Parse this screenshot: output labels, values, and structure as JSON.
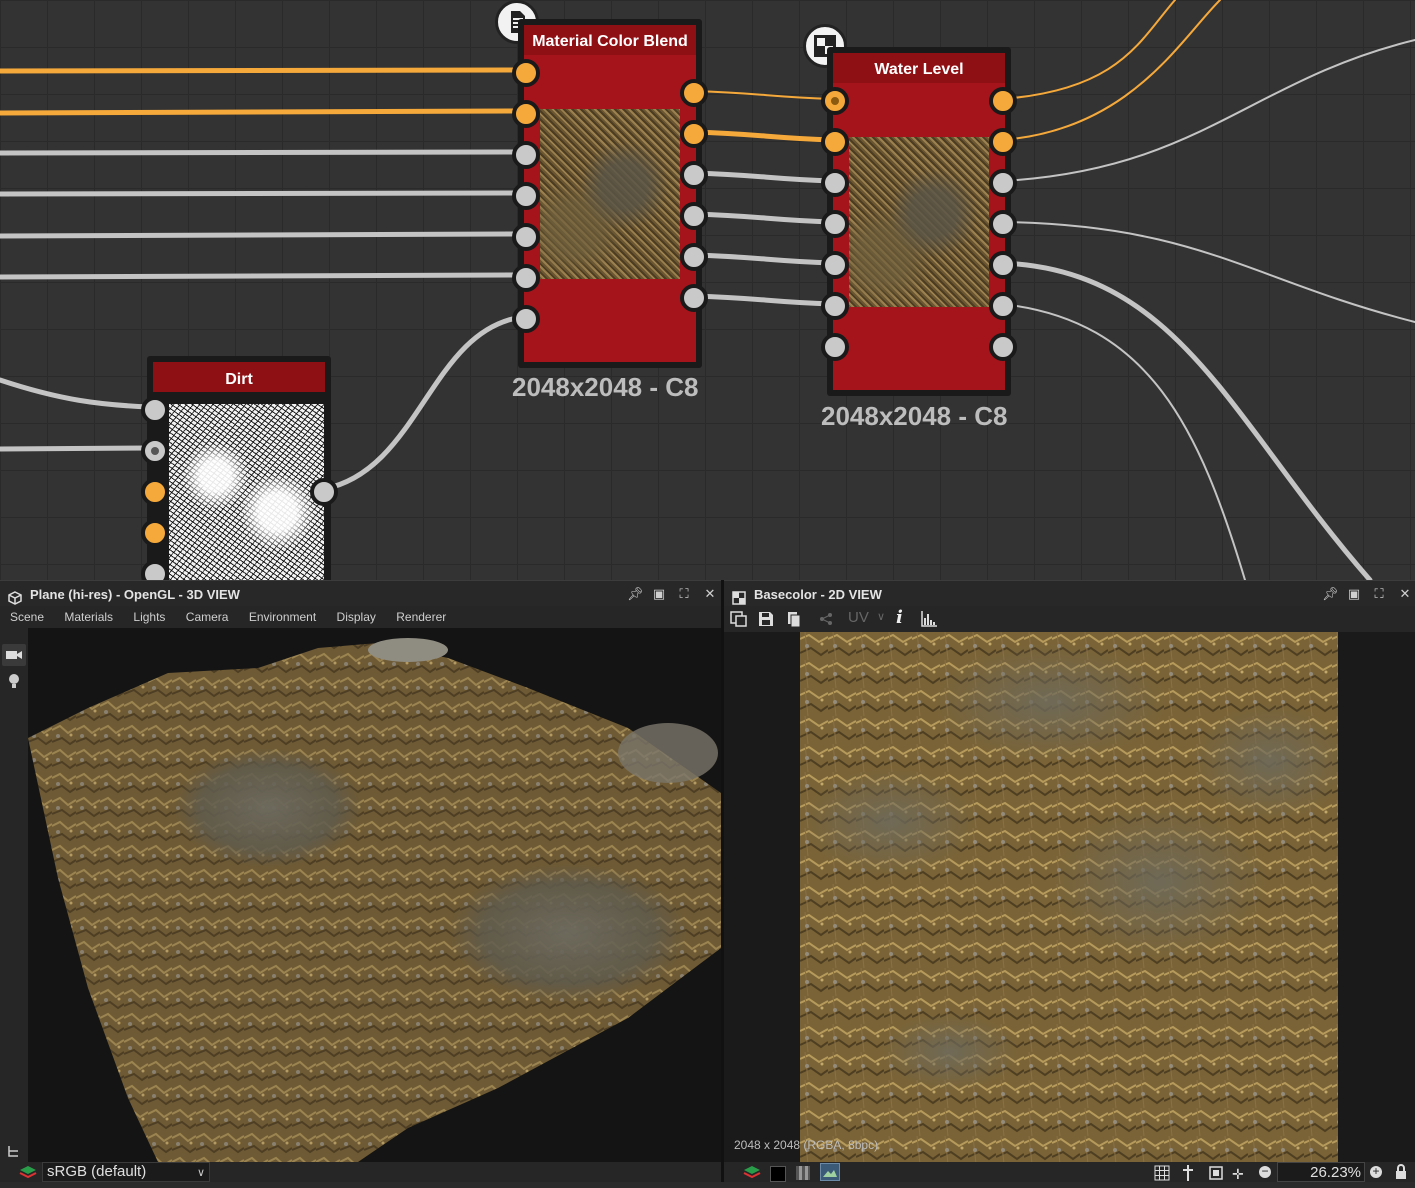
{
  "graph": {
    "nodes": {
      "material_color_blend": {
        "title": "Material Color Blend",
        "resolution": "2048x2048 - C8",
        "badge_icon": "document-icon"
      },
      "water_level": {
        "title": "Water Level",
        "resolution": "2048x2048 - C8",
        "badge_icon": "checker-icon"
      },
      "dirt": {
        "title": "Dirt"
      }
    },
    "colors": {
      "node_header": "#8f1014",
      "node_body": "#a5141a",
      "wire_orange": "#f6a93b",
      "wire_grey": "#c4c4c4"
    }
  },
  "panel3d": {
    "title": "Plane (hi-res) - OpenGL - 3D VIEW",
    "menu": [
      "Scene",
      "Materials",
      "Lights",
      "Camera",
      "Environment",
      "Display",
      "Renderer"
    ],
    "status": {
      "colorspace": "sRGB (default)"
    }
  },
  "panel2d": {
    "title": "Basecolor - 2D VIEW",
    "uv_label": "UV",
    "info_text": "2048 x 2048 (RGBA, 8bpc)",
    "zoom": "26.23%"
  }
}
